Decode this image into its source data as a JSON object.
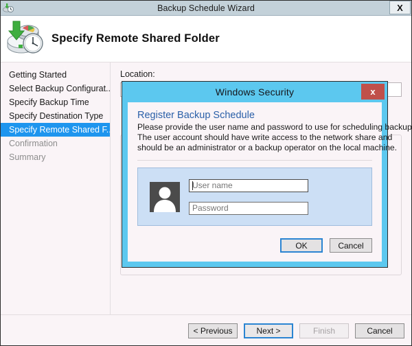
{
  "window": {
    "title": "Backup Schedule Wizard",
    "app_icon": "backup-schedule-icon",
    "close_label": "X"
  },
  "header": {
    "title": "Specify Remote Shared Folder",
    "icon": "backup-disk-clock-icon"
  },
  "sidebar": {
    "items": [
      {
        "label": "Getting Started",
        "state": "normal"
      },
      {
        "label": "Select Backup Configurat...",
        "state": "normal"
      },
      {
        "label": "Specify Backup Time",
        "state": "normal"
      },
      {
        "label": "Specify Destination Type",
        "state": "normal"
      },
      {
        "label": "Specify Remote Shared F...",
        "state": "selected"
      },
      {
        "label": "Confirmation",
        "state": "dim"
      },
      {
        "label": "Summary",
        "state": "dim"
      }
    ]
  },
  "content": {
    "location_label": "Location:",
    "location_value": ""
  },
  "footer": {
    "previous_label": "< Previous",
    "next_label": "Next >",
    "finish_label": "Finish",
    "cancel_label": "Cancel"
  },
  "dialog": {
    "title": "Windows Security",
    "close_label": "x",
    "heading": "Register Backup Schedule",
    "description_line1": "Please provide the user name and password to use for scheduling backup.",
    "description_line2": "The user account should have write access to the network share and",
    "description_line3": "should be an administrator or a backup operator on the local machine.",
    "avatar_icon": "user-avatar-icon",
    "username_placeholder": "User name",
    "username_value": "",
    "password_placeholder": "Password",
    "password_value": "",
    "ok_label": "OK",
    "cancel_label": "Cancel"
  },
  "colors": {
    "titlebar": "#c3d1d9",
    "sidebar_selected": "#1e95ee",
    "dialog_frame": "#5cc8ef",
    "dialog_close": "#c0504a",
    "dialog_heading": "#2a5fa8",
    "cred_panel": "#ccdff5",
    "focus_border": "#2a84d2"
  }
}
